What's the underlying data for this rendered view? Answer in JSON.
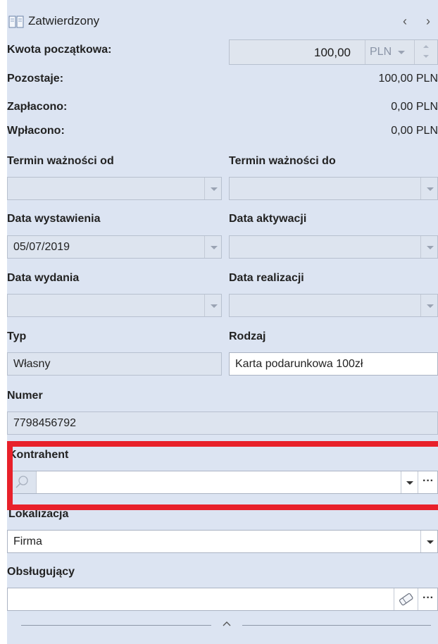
{
  "header": {
    "status": "Zatwierdzony",
    "prev_icon": "chevron-left-icon",
    "next_icon": "chevron-right-icon"
  },
  "amounts": {
    "initial_label": "Kwota początkowa:",
    "initial_value": "100,00",
    "initial_currency": "PLN",
    "remaining_label": "Pozostaje:",
    "remaining_value": "100,00 PLN",
    "paid_label": "Zapłacono:",
    "paid_value": "0,00 PLN",
    "deposited_label": "Wpłacono:",
    "deposited_value": "0,00 PLN"
  },
  "dates": {
    "valid_from_label": "Termin ważności od",
    "valid_from_value": "",
    "valid_to_label": "Termin ważności do",
    "valid_to_value": "",
    "issue_label": "Data wystawienia",
    "issue_value": "05/07/2019",
    "activation_label": "Data aktywacji",
    "activation_value": "",
    "release_label": "Data wydania",
    "release_value": "",
    "realization_label": "Data realizacji",
    "realization_value": ""
  },
  "type": {
    "label": "Typ",
    "value": "Własny"
  },
  "kind": {
    "label": "Rodzaj",
    "value": "Karta podarunkowa 100zł"
  },
  "number": {
    "label": "Numer",
    "value": "7798456792"
  },
  "contractor": {
    "label": "Kontrahent",
    "value": ""
  },
  "location": {
    "label": "Lokalizacja",
    "value": "Firma"
  },
  "handler": {
    "label": "Obsługujący",
    "value": ""
  },
  "colors": {
    "panel_bg": "#dce4f2",
    "highlight": "#e8202a"
  }
}
